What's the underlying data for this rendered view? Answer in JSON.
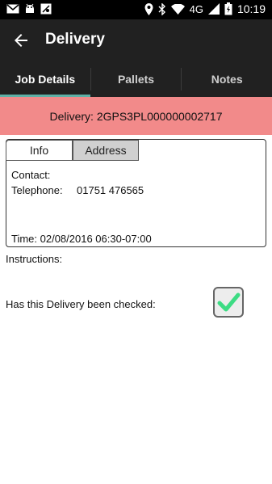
{
  "status_bar": {
    "network": "4G",
    "time": "10:19",
    "left_icons": [
      "gmail-icon",
      "android-icon",
      "map-icon"
    ],
    "right_icons": [
      "location-icon",
      "bluetooth-icon",
      "wifi-icon",
      "signal-icon",
      "battery-icon"
    ]
  },
  "app_bar": {
    "title": "Delivery",
    "back_icon": "arrow-left-icon"
  },
  "tabs": [
    {
      "label": "Job Details",
      "active": true
    },
    {
      "label": "Pallets",
      "active": false
    },
    {
      "label": "Notes",
      "active": false
    }
  ],
  "banner": {
    "text": "Delivery: 2GPS3PL000000002717",
    "color": "#f28a8a"
  },
  "info_panel": {
    "tabs": [
      {
        "label": "Info",
        "selected": true
      },
      {
        "label": "Address",
        "selected": false
      }
    ],
    "contact_label": "Contact:",
    "telephone_label": "Telephone:",
    "telephone_value": "01751 476565",
    "time_text": "Time: 02/08/2016 06:30-07:00"
  },
  "instructions_label": "Instructions:",
  "checked": {
    "label": "Has this Delivery been checked:",
    "value": true,
    "check_color": "#3ddc84"
  },
  "colors": {
    "app_bar": "#212121",
    "tab_indicator": "#5fb1a7"
  }
}
